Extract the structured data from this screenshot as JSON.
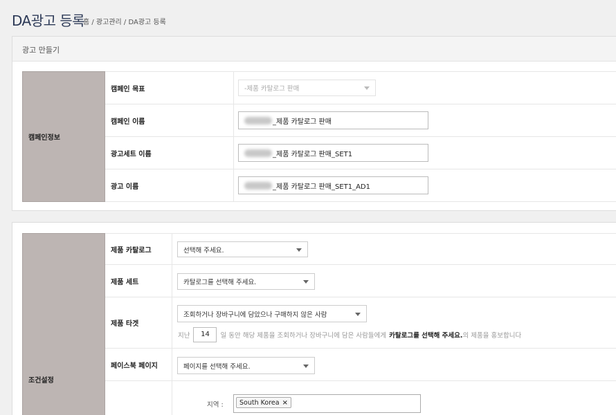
{
  "page": {
    "title": "DA광고 등록",
    "breadcrumb": "홈 / 광고관리 / DA광고 등록"
  },
  "campaign_panel": {
    "heading": "광고 만들기",
    "section_label": "캠페인정보",
    "rows": [
      {
        "label": "캠페인 목표",
        "value": "-제품 카탈로그 판매"
      },
      {
        "label": "캠페인 이름",
        "value": "_제품 카탈로그 판매"
      },
      {
        "label": "광고세트 이름",
        "value": "_제품 카탈로그 판매_SET1"
      },
      {
        "label": "광고 이름",
        "value": "_제품 카탈로그 판매_SET1_AD1"
      }
    ]
  },
  "condition_panel": {
    "section_label": "조건설정",
    "catalog": {
      "label": "제품 카탈로그",
      "value": "선택해 주세요."
    },
    "product_set": {
      "label": "제품 세트",
      "value": "카탈로그를 선택해 주세요."
    },
    "target": {
      "label": "제품 타겟",
      "value": "조회하거나 장바구니에 담았으나 구매하지 않은 사람",
      "hint_prefix": "지난",
      "days": "14",
      "hint_middle": "일 동안 해당 제품을 조회하거나 장바구니에 담은 사람들에게",
      "hint_strong": "카탈로그를 선택해 주세요.",
      "hint_suffix": "의 제품을 홍보합니다"
    },
    "facebook_page": {
      "label": "페이스북 페이지",
      "value": "페이지를 선택해 주세요."
    },
    "region": {
      "label": "지역 :",
      "tag": "South Korea",
      "remove": "×"
    }
  }
}
